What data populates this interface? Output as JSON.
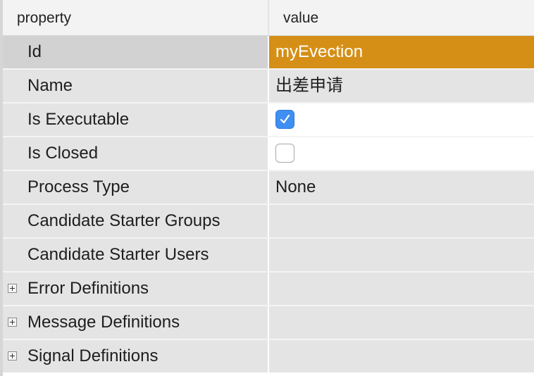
{
  "header": {
    "property_label": "property",
    "value_label": "value"
  },
  "rows": [
    {
      "property": "Id",
      "value": "myEvection",
      "selected": true
    },
    {
      "property": "Name",
      "value": "出差申请"
    },
    {
      "property": "Is Executable",
      "checked": true
    },
    {
      "property": "Is Closed",
      "checked": false
    },
    {
      "property": "Process Type",
      "value": "None"
    },
    {
      "property": "Candidate Starter Groups",
      "value": ""
    },
    {
      "property": "Candidate Starter Users",
      "value": ""
    },
    {
      "property": "Error Definitions",
      "value": "",
      "expandable": true
    },
    {
      "property": "Message Definitions",
      "value": "",
      "expandable": true
    },
    {
      "property": "Signal Definitions",
      "value": "",
      "expandable": true
    }
  ],
  "colors": {
    "selected_value_bg": "#d58f16",
    "checkbox_checked": "#3f8ef1",
    "row_bg": "#e4e4e4"
  },
  "icons": [
    "checkmark-icon",
    "expand-plus-icon"
  ]
}
